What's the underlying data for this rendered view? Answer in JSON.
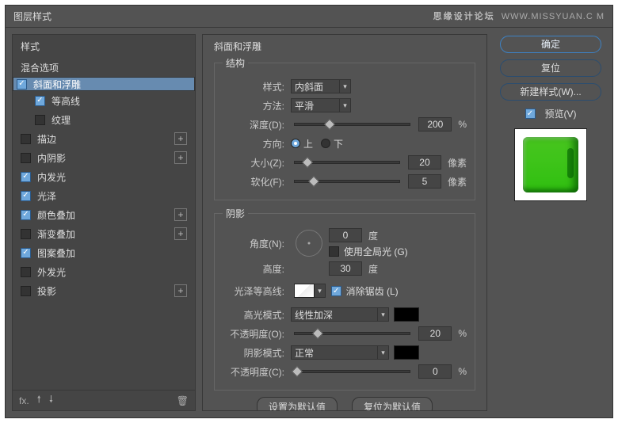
{
  "title": "图层样式",
  "watermark_brand": "思缘设计论坛",
  "watermark_url": "WWW.MISSYUAN.C M",
  "left": {
    "hdr": "样式",
    "blend": "混合选项",
    "items": [
      {
        "label": "斜面和浮雕",
        "checked": true,
        "plus": false,
        "sel": true
      },
      {
        "label": "等高线",
        "checked": true,
        "plus": false,
        "indent": true
      },
      {
        "label": "纹理",
        "checked": false,
        "plus": false,
        "indent": true
      },
      {
        "label": "描边",
        "checked": false,
        "plus": true
      },
      {
        "label": "内阴影",
        "checked": false,
        "plus": true
      },
      {
        "label": "内发光",
        "checked": true,
        "plus": false
      },
      {
        "label": "光泽",
        "checked": true,
        "plus": false
      },
      {
        "label": "颜色叠加",
        "checked": true,
        "plus": true
      },
      {
        "label": "渐变叠加",
        "checked": false,
        "plus": true
      },
      {
        "label": "图案叠加",
        "checked": true,
        "plus": false
      },
      {
        "label": "外发光",
        "checked": false,
        "plus": false
      },
      {
        "label": "投影",
        "checked": false,
        "plus": true
      }
    ]
  },
  "center": {
    "heading": "斜面和浮雕",
    "structure": {
      "legend": "结构",
      "style_label": "样式:",
      "style_value": "内斜面",
      "method_label": "方法:",
      "method_value": "平滑",
      "depth_label": "深度(D):",
      "depth_value": "200",
      "depth_unit": "%",
      "direction_label": "方向:",
      "dir_up": "上",
      "dir_down": "下",
      "size_label": "大小(Z):",
      "size_value": "20",
      "size_unit": "像素",
      "soften_label": "软化(F):",
      "soften_value": "5",
      "soften_unit": "像素"
    },
    "shadow": {
      "legend": "阴影",
      "angle_label": "角度(N):",
      "angle_value": "0",
      "angle_unit": "度",
      "global_label": "使用全局光 (G)",
      "alt_label": "高度:",
      "alt_value": "30",
      "alt_unit": "度",
      "gloss_label": "光泽等高线:",
      "antialias_label": "消除锯齿 (L)",
      "hmode_label": "高光模式:",
      "hmode_value": "线性加深",
      "hopacity_label": "不透明度(O):",
      "hopacity_value": "20",
      "hopacity_unit": "%",
      "smode_label": "阴影模式:",
      "smode_value": "正常",
      "sopacity_label": "不透明度(C):",
      "sopacity_value": "0",
      "sopacity_unit": "%"
    },
    "defaults_set": "设置为默认值",
    "defaults_reset": "复位为默认值"
  },
  "right": {
    "ok": "确定",
    "reset": "复位",
    "newstyle": "新建样式(W)...",
    "preview_label": "预览(V)"
  }
}
